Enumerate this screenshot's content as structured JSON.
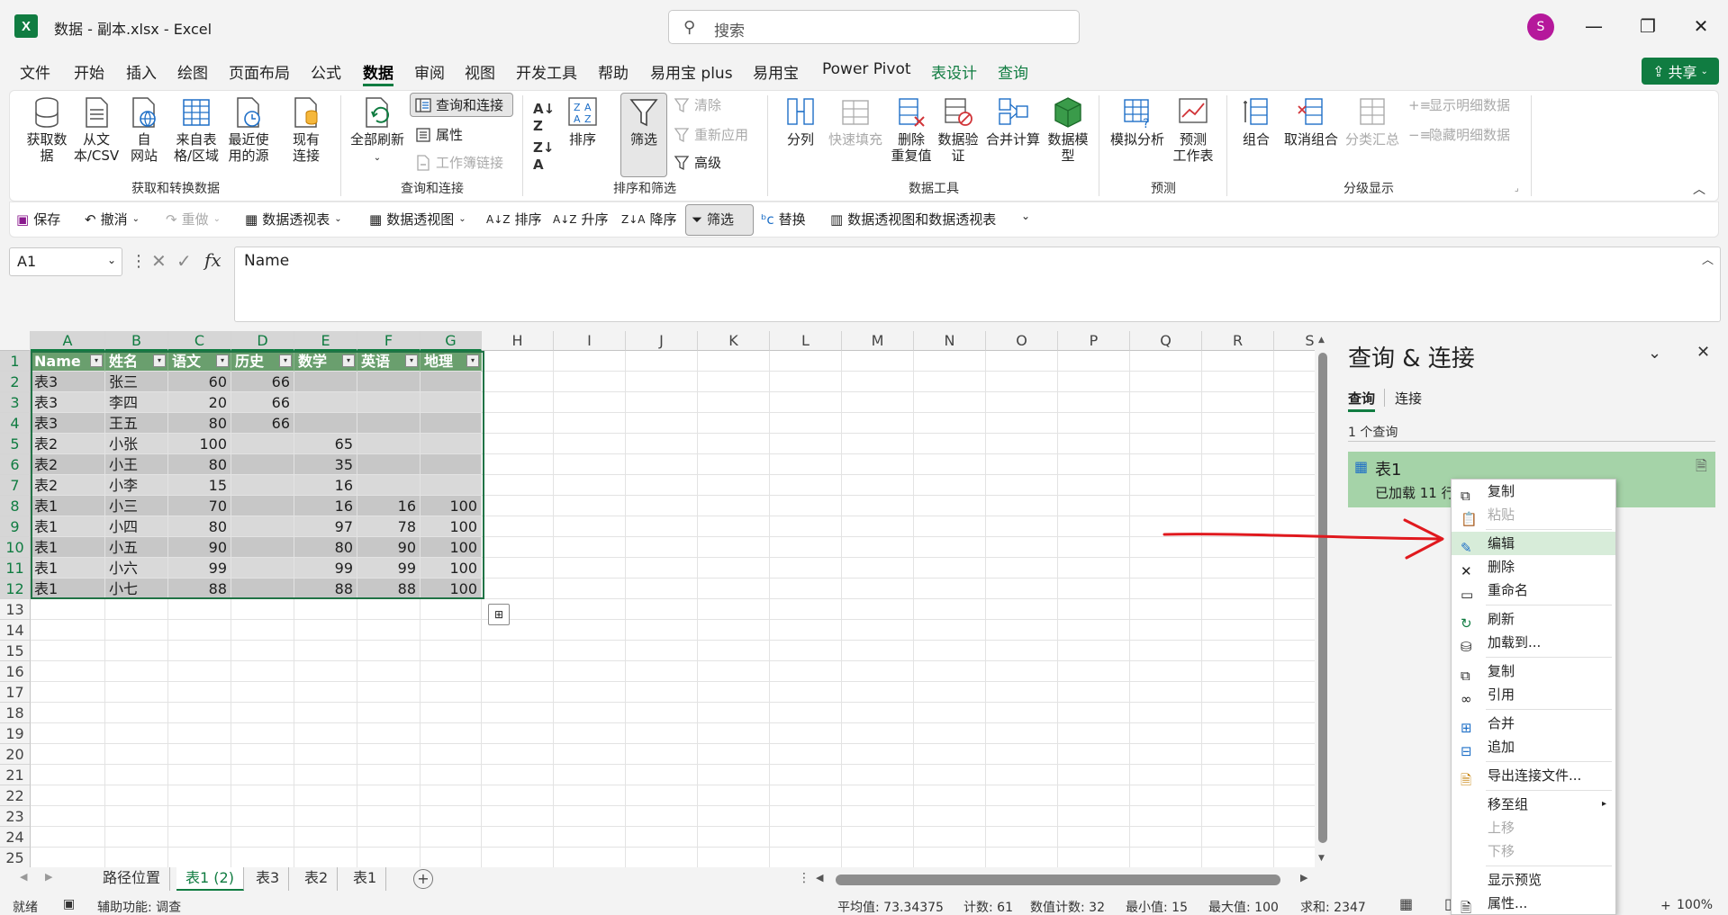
{
  "window": {
    "app_logo": "X",
    "title": "数据 - 副本.xlsx  -  Excel",
    "search_placeholder": "搜索",
    "avatar_initial": "S"
  },
  "menu": {
    "tabs": [
      "文件",
      "开始",
      "插入",
      "绘图",
      "页面布局",
      "公式",
      "数据",
      "审阅",
      "视图",
      "开发工具",
      "帮助",
      "易用宝 plus",
      "易用宝",
      "Power Pivot",
      "表设计",
      "查询"
    ],
    "active_tab": "数据",
    "share_label": "共享"
  },
  "ribbon": {
    "get_data": "获取数\n据",
    "from_text": "从文\n本/CSV",
    "from_web": "自\n网站",
    "from_table": "来自表\n格/区域",
    "recent_sources": "最近使\n用的源",
    "existing_conn": "现有\n连接",
    "group_get": "获取和转换数据",
    "refresh_all": "全部刷新",
    "queries_conn": "查询和连接",
    "properties": "属性",
    "workbook_links": "工作簿链接",
    "group_query": "查询和连接",
    "sort": "排序",
    "filter": "筛选",
    "clear": "清除",
    "reapply": "重新应用",
    "advanced": "高级",
    "group_sort": "排序和筛选",
    "split": "分列",
    "flash_fill": "快速填充",
    "remove_dup": "删除\n重复值",
    "validation": "数据验\n证",
    "consolidate": "合并计算",
    "data_model": "数据模\n型",
    "group_tools": "数据工具",
    "what_if": "模拟分析",
    "forecast": "预测\n工作表",
    "group_forecast": "预测",
    "group_btn": "组合",
    "ungroup": "取消组合",
    "subtotal": "分类汇总",
    "show_detail": "显示明细数据",
    "hide_detail": "隐藏明细数据",
    "group_outline": "分级显示"
  },
  "qat": {
    "save": "保存",
    "undo": "撤消",
    "redo": "重做",
    "pivot_table": "数据透视表",
    "pivot_chart": "数据透视图",
    "sort": "排序",
    "asc": "升序",
    "desc": "降序",
    "filter": "筛选",
    "replace": "替换",
    "pivot_both": "数据透视图和数据透视表"
  },
  "formula": {
    "name_box": "A1",
    "content": "Name"
  },
  "grid": {
    "columns": [
      "A",
      "B",
      "C",
      "D",
      "E",
      "F",
      "G",
      "H",
      "I",
      "J",
      "K",
      "L",
      "M",
      "N",
      "O",
      "P",
      "Q",
      "R",
      "S"
    ],
    "rows": [
      "1",
      "2",
      "3",
      "4",
      "5",
      "6",
      "7",
      "8",
      "9",
      "10",
      "11",
      "12",
      "13",
      "14",
      "15",
      "16",
      "17",
      "18",
      "19",
      "20",
      "21",
      "22",
      "23",
      "24",
      "25"
    ],
    "headers": [
      "Name",
      "姓名",
      "语文",
      "历史",
      "数学",
      "英语",
      "地理"
    ],
    "data": [
      [
        "表3",
        "张三",
        "60",
        "66",
        "",
        "",
        ""
      ],
      [
        "表3",
        "李四",
        "20",
        "66",
        "",
        "",
        ""
      ],
      [
        "表3",
        "王五",
        "80",
        "66",
        "",
        "",
        ""
      ],
      [
        "表2",
        "小张",
        "100",
        "",
        "65",
        "",
        ""
      ],
      [
        "表2",
        "小王",
        "80",
        "",
        "35",
        "",
        ""
      ],
      [
        "表2",
        "小李",
        "15",
        "",
        "16",
        "",
        ""
      ],
      [
        "表1",
        "小三",
        "70",
        "",
        "16",
        "16",
        "100"
      ],
      [
        "表1",
        "小四",
        "80",
        "",
        "97",
        "78",
        "100"
      ],
      [
        "表1",
        "小五",
        "90",
        "",
        "80",
        "90",
        "100"
      ],
      [
        "表1",
        "小六",
        "99",
        "",
        "99",
        "99",
        "100"
      ],
      [
        "表1",
        "小七",
        "88",
        "",
        "88",
        "88",
        "100"
      ]
    ]
  },
  "sheets": {
    "tabs": [
      "路径位置",
      "表1 (2)",
      "表3",
      "表2",
      "表1"
    ],
    "active": "表1 (2)"
  },
  "status": {
    "mode": "就绪",
    "accessibility": "辅助功能: 调查",
    "average": "平均值: 73.34375",
    "count": "计数: 61",
    "numcount": "数值计数: 32",
    "min": "最小值: 15",
    "max": "最大值: 100",
    "sum": "求和: 2347",
    "zoom": "100%"
  },
  "query_pane": {
    "title": "查询 & 连接",
    "tab_queries": "查询",
    "tab_connections": "连接",
    "count": "1 个查询",
    "item_name": "表1",
    "item_status": "已加载 11 行"
  },
  "context_menu": {
    "items": [
      "复制",
      "粘贴",
      "编辑",
      "删除",
      "重命名",
      "刷新",
      "加载到...",
      "复制",
      "引用",
      "合并",
      "追加",
      "导出连接文件...",
      "移至组",
      "上移",
      "下移",
      "显示预览",
      "属性..."
    ]
  },
  "colors": {
    "accent": "#107c41",
    "header_fill": "#6a9f6e",
    "band_dark": "#c7c7c7",
    "band_light": "#d9d9d9",
    "arrow": "#e0191e"
  }
}
